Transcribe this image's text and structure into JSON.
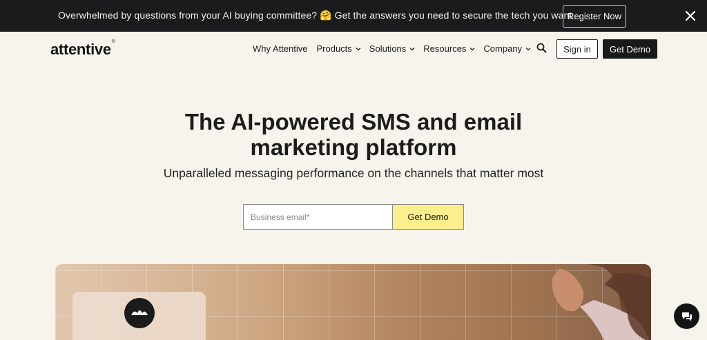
{
  "announcement": {
    "text": "Overwhelmed by questions from your AI buying committee? 🤗 Get the answers you need to secure the tech you want",
    "register_label": "Register Now"
  },
  "nav": {
    "logo": "attentive",
    "logo_mark": "®",
    "links": [
      {
        "label": "Why Attentive",
        "has_dropdown": false
      },
      {
        "label": "Products",
        "has_dropdown": true
      },
      {
        "label": "Solutions",
        "has_dropdown": true
      },
      {
        "label": "Resources",
        "has_dropdown": true
      },
      {
        "label": "Company",
        "has_dropdown": true
      }
    ],
    "signin_label": "Sign in",
    "demo_label": "Get Demo"
  },
  "hero": {
    "title_line1": "The AI-powered SMS and email",
    "title_line2": "marketing platform",
    "subtitle": "Unparalleled messaging performance on the channels that matter most",
    "email_placeholder": "Business email*",
    "demo_label": "Get Demo"
  },
  "colors": {
    "announcement_bg": "#1a1b1d",
    "page_bg": "#f7f4ee",
    "primary_dark": "#18191b",
    "accent_yellow": "#fbee8d"
  },
  "icons": {
    "close": "close-icon",
    "search": "search-icon",
    "dropdown": "chevron-down-icon",
    "chat": "chat-icon"
  }
}
